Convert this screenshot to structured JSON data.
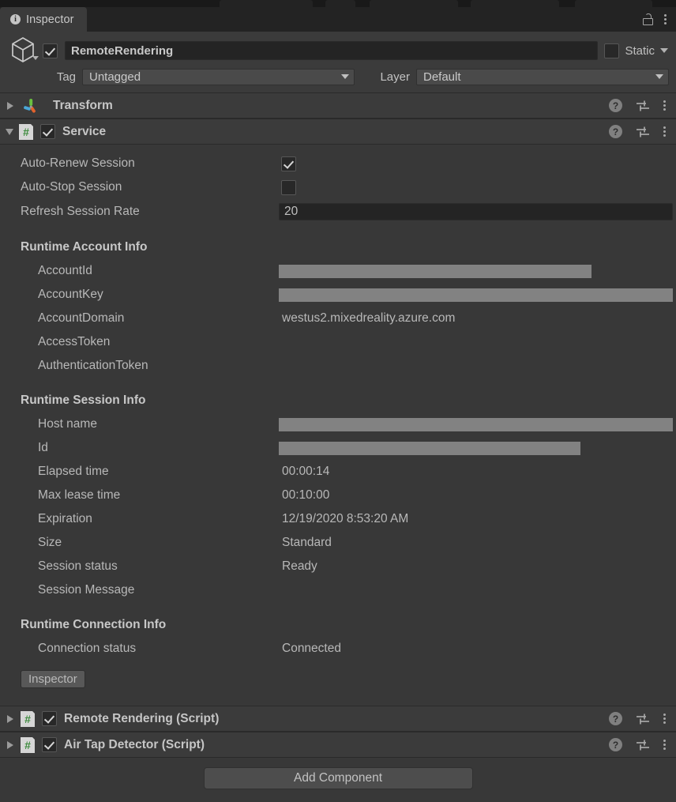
{
  "window": {
    "tab_label": "Inspector",
    "info_icon": "info-icon",
    "lock_icon": "lock-icon",
    "menu_icon": "kebab-menu-icon"
  },
  "object_header": {
    "enabled": true,
    "name": "RemoteRendering",
    "static_label": "Static",
    "static_checked": false,
    "tag_label": "Tag",
    "tag_value": "Untagged",
    "layer_label": "Layer",
    "layer_value": "Default",
    "cube_icon": "gameobject-cube-icon"
  },
  "components": [
    {
      "title": "Transform",
      "icon": "transform-gizmo-icon",
      "expanded": false,
      "has_enable_toggle": false
    },
    {
      "title": "Service",
      "icon": "csharp-script-icon",
      "expanded": true,
      "has_enable_toggle": true,
      "enabled": true
    }
  ],
  "service": {
    "settings": [
      {
        "label": "Auto-Renew Session",
        "type": "checkbox",
        "checked": true
      },
      {
        "label": "Auto-Stop Session",
        "type": "checkbox",
        "checked": false
      },
      {
        "label": "Refresh Session Rate",
        "type": "number",
        "value": "20"
      }
    ],
    "account_info": {
      "heading": "Runtime Account Info",
      "rows": [
        {
          "label": "AccountId",
          "value": "",
          "redacted": true,
          "redact_width": 396
        },
        {
          "label": "AccountKey",
          "value": "",
          "redacted": true,
          "redact_width": 499
        },
        {
          "label": "AccountDomain",
          "value": "westus2.mixedreality.azure.com",
          "redacted": false
        },
        {
          "label": "AccessToken",
          "value": "",
          "redacted": false
        },
        {
          "label": "AuthenticationToken",
          "value": "",
          "redacted": false
        }
      ]
    },
    "session_info": {
      "heading": "Runtime Session Info",
      "rows": [
        {
          "label": "Host name",
          "value": "",
          "redacted": true,
          "redact_width": 499
        },
        {
          "label": "Id",
          "value": "",
          "redacted": true,
          "redact_width": 382
        },
        {
          "label": "Elapsed time",
          "value": "00:00:14",
          "redacted": false
        },
        {
          "label": "Max lease time",
          "value": "00:10:00",
          "redacted": false
        },
        {
          "label": "Expiration",
          "value": "12/19/2020 8:53:20 AM",
          "redacted": false
        },
        {
          "label": "Size",
          "value": "Standard",
          "redacted": false
        },
        {
          "label": "Session status",
          "value": "Ready",
          "redacted": false
        },
        {
          "label": "Session Message",
          "value": "",
          "redacted": false
        }
      ]
    },
    "connection_info": {
      "heading": "Runtime Connection Info",
      "rows": [
        {
          "label": "Connection status",
          "value": "Connected",
          "redacted": false
        }
      ]
    },
    "inspector_button_label": "Inspector"
  },
  "scripts": [
    {
      "title": "Remote Rendering (Script)",
      "enabled": true
    },
    {
      "title": "Air Tap Detector (Script)",
      "enabled": true
    }
  ],
  "footer": {
    "add_component_label": "Add Component"
  },
  "colors": {
    "window_bg": "#383838",
    "header_bg": "#3b3b3b",
    "tabbar_bg": "#232323",
    "text": "#b8b8b8",
    "redaction": "#828282",
    "script_green": "#3d8b3d"
  }
}
